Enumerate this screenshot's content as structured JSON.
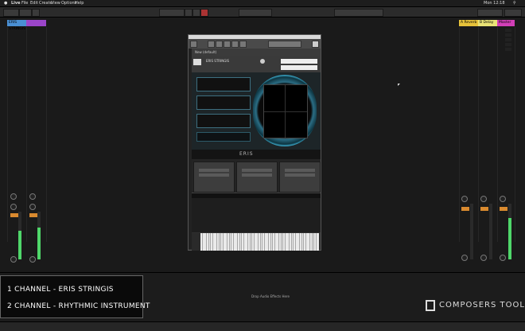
{
  "menubar": {
    "app": "Live",
    "items": [
      "File",
      "Edit",
      "Create",
      "View",
      "Options",
      "Help"
    ],
    "clock": "Mon 12:18"
  },
  "tracks": {
    "left": [
      {
        "name": "ERIS STRINGIS",
        "color": "#4a8fd3"
      },
      {
        "name": "",
        "color": "#9b45c9"
      }
    ],
    "right": [
      {
        "name": "A Reverb",
        "color": "#e6c23a"
      },
      {
        "name": "B Delay",
        "color": "#e8e276"
      },
      {
        "name": "Master",
        "color": "#d23fb7"
      }
    ]
  },
  "kontakt": {
    "multi_name": "New (default)",
    "instrument": "ERIS STRINGIS",
    "bottom_label": "ERIS"
  },
  "caption": {
    "line1": "1 CHANNEL - ERIS STRINGIS",
    "line2": "2 CHANNEL - RHYTHMIC INSTRUMENT"
  },
  "drop_hint": "Drop Audio Effects Here",
  "brand": "COMPOSERS TOOLS",
  "colors": {
    "meter": "#4fd76a",
    "accent": "#d98a2f",
    "kontakt_teal": "#3aa6c6"
  },
  "icons": [
    "apple-icon",
    "search-icon",
    "wifi-icon",
    "scope-icon",
    "logo-icon"
  ]
}
